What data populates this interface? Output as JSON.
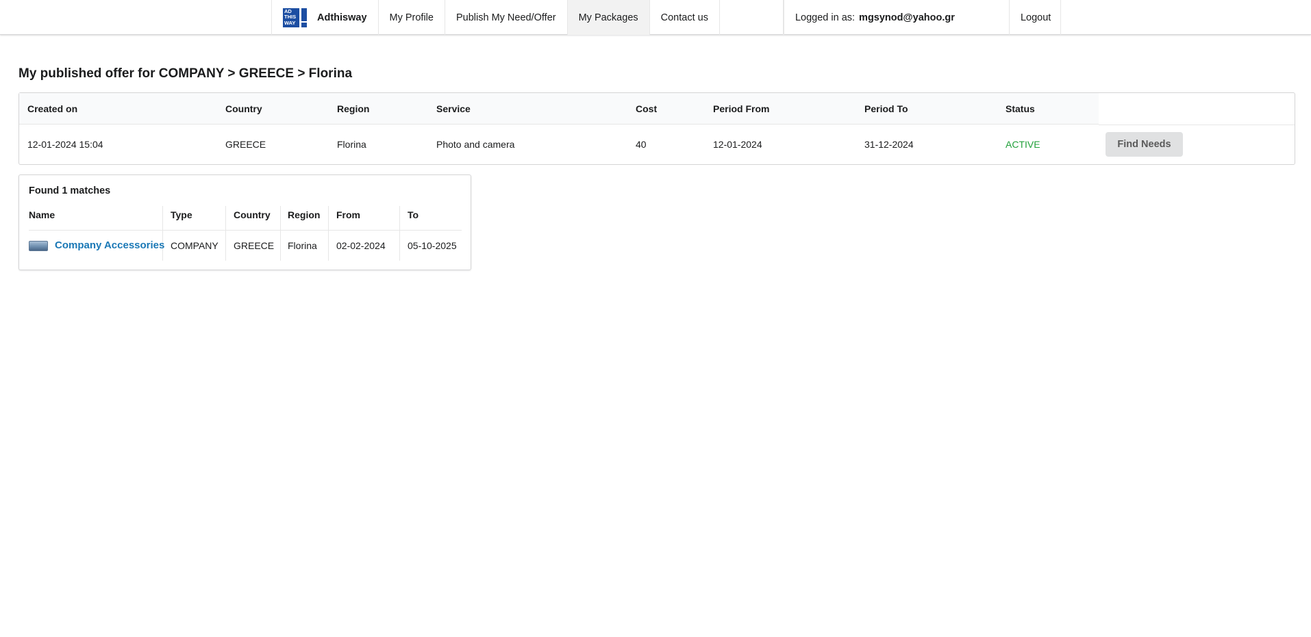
{
  "nav": {
    "logo_text": "AD THIS WAY",
    "brand": "Adthisway",
    "items": [
      "My Profile",
      "Publish My Need/Offer",
      "My Packages",
      "Contact us"
    ],
    "active": "My Packages",
    "logged_label": "Logged in as:",
    "user_email": "mgsynod@yahoo.gr",
    "logout": "Logout"
  },
  "page_title": "My published offer for COMPANY > GREECE > Florina",
  "offer": {
    "headers": [
      "Created on",
      "Country",
      "Region",
      "Service",
      "Cost",
      "Period From",
      "Period To",
      "Status"
    ],
    "row": {
      "created_on": "12-01-2024 15:04",
      "country": "GREECE",
      "region": "Florina",
      "service": "Photo and camera",
      "cost": "40",
      "period_from": "12-01-2024",
      "period_to": "31-12-2024",
      "status": "ACTIVE"
    },
    "button": "Find Needs",
    "status_color": "#21a03a"
  },
  "matches": {
    "title": "Found 1 matches",
    "headers": [
      "Name",
      "Type",
      "Country",
      "Region",
      "From",
      "To"
    ],
    "rows": [
      {
        "name": "Company Accessories",
        "type": "COMPANY",
        "country": "GREECE",
        "region": "Florina",
        "from": "02-02-2024",
        "to": "05-10-2025"
      }
    ],
    "link_color": "#1a78b6"
  }
}
